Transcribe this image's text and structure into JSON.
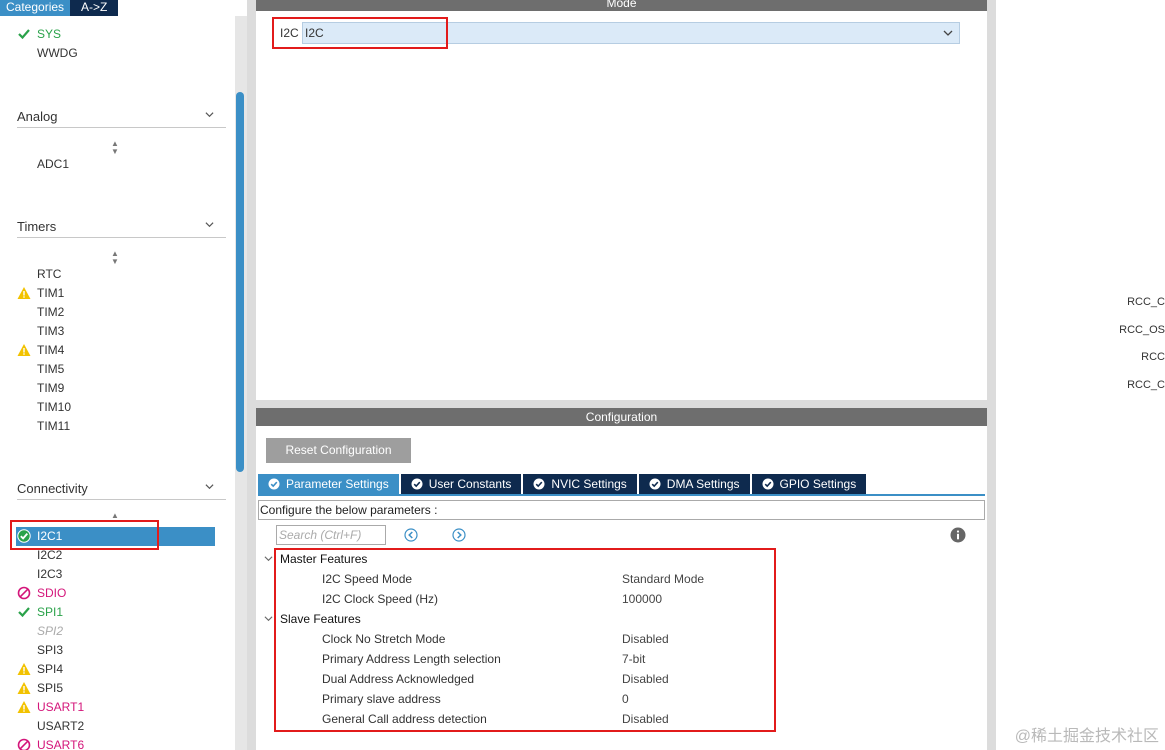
{
  "left_panel": {
    "tabs": [
      "Categories",
      "A->Z"
    ],
    "system_items": [
      {
        "label": "SYS",
        "status": "ok"
      },
      {
        "label": "WWDG",
        "status": "none"
      }
    ],
    "categories": {
      "analog": {
        "title": "Analog",
        "items": [
          {
            "label": "ADC1",
            "status": "none"
          }
        ]
      },
      "timers": {
        "title": "Timers",
        "items": [
          {
            "label": "RTC",
            "status": "none"
          },
          {
            "label": "TIM1",
            "status": "warning"
          },
          {
            "label": "TIM2",
            "status": "none"
          },
          {
            "label": "TIM3",
            "status": "none"
          },
          {
            "label": "TIM4",
            "status": "warning"
          },
          {
            "label": "TIM5",
            "status": "none"
          },
          {
            "label": "TIM9",
            "status": "none"
          },
          {
            "label": "TIM10",
            "status": "none"
          },
          {
            "label": "TIM11",
            "status": "none"
          }
        ]
      },
      "connectivity": {
        "title": "Connectivity",
        "items": [
          {
            "label": "I2C1",
            "status": "selected"
          },
          {
            "label": "I2C2",
            "status": "none"
          },
          {
            "label": "I2C3",
            "status": "none"
          },
          {
            "label": "SDIO",
            "status": "disabled"
          },
          {
            "label": "SPI1",
            "status": "ok"
          },
          {
            "label": "SPI2",
            "status": "unavailable"
          },
          {
            "label": "SPI3",
            "status": "none"
          },
          {
            "label": "SPI4",
            "status": "warning"
          },
          {
            "label": "SPI5",
            "status": "warning"
          },
          {
            "label": "USART1",
            "status": "warning"
          },
          {
            "label": "USART2",
            "status": "none"
          },
          {
            "label": "USART6",
            "status": "disabled"
          }
        ]
      }
    }
  },
  "mode_panel": {
    "title": "Mode",
    "field_label": "I2C",
    "select_value": "I2C"
  },
  "config_panel": {
    "title": "Configuration",
    "reset_button": "Reset Configuration",
    "tabs": [
      "Parameter Settings",
      "User Constants",
      "NVIC Settings",
      "DMA Settings",
      "GPIO Settings"
    ],
    "active_tab": "Parameter Settings",
    "instruction": "Configure the below parameters :",
    "search_placeholder": "Search (Ctrl+F)",
    "groups": {
      "master": {
        "title": "Master Features",
        "params": [
          {
            "name": "I2C Speed Mode",
            "value": "Standard Mode"
          },
          {
            "name": "I2C Clock Speed (Hz)",
            "value": "100000"
          }
        ]
      },
      "slave": {
        "title": "Slave Features",
        "params": [
          {
            "name": "Clock No Stretch Mode",
            "value": "Disabled"
          },
          {
            "name": "Primary Address Length selection",
            "value": "7-bit"
          },
          {
            "name": "Dual Address Acknowledged",
            "value": "Disabled"
          },
          {
            "name": "Primary slave address",
            "value": "0"
          },
          {
            "name": "General Call address detection",
            "value": "Disabled"
          }
        ]
      }
    }
  },
  "right_panel": {
    "pin_labels": [
      "RCC_C",
      "RCC_OS",
      "RCC",
      "RCC_C"
    ],
    "watermark": "@稀土掘金技术社区"
  },
  "colors": {
    "accent": "#3b8fc6",
    "dark_tab": "#0e2a4e",
    "header_gray": "#6e6e6e",
    "ok_green": "#2aa24a",
    "warning_yellow": "#f2c200",
    "disabled_pink": "#d4157a",
    "highlight_red": "#e21b1b"
  }
}
